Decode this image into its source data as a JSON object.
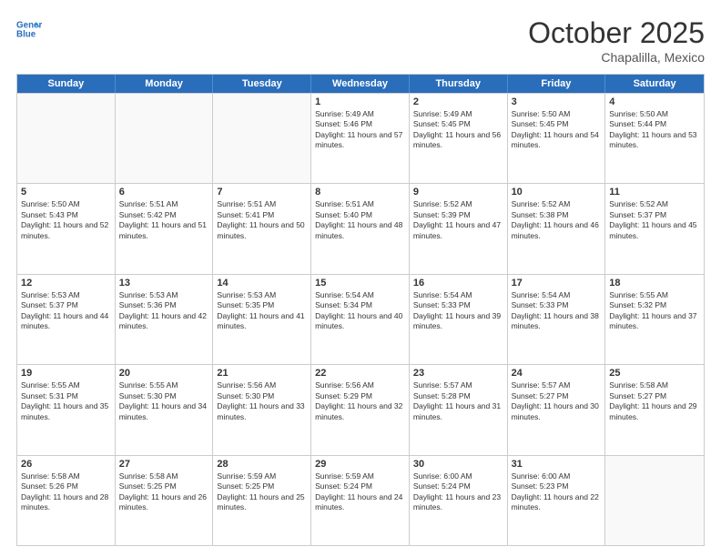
{
  "header": {
    "logo_general": "General",
    "logo_blue": "Blue",
    "month": "October 2025",
    "location": "Chapalilla, Mexico"
  },
  "days_of_week": [
    "Sunday",
    "Monday",
    "Tuesday",
    "Wednesday",
    "Thursday",
    "Friday",
    "Saturday"
  ],
  "weeks": [
    [
      {
        "day": "",
        "empty": true
      },
      {
        "day": "",
        "empty": true
      },
      {
        "day": "",
        "empty": true
      },
      {
        "day": "1",
        "sunrise": "Sunrise: 5:49 AM",
        "sunset": "Sunset: 5:46 PM",
        "daylight": "Daylight: 11 hours and 57 minutes."
      },
      {
        "day": "2",
        "sunrise": "Sunrise: 5:49 AM",
        "sunset": "Sunset: 5:45 PM",
        "daylight": "Daylight: 11 hours and 56 minutes."
      },
      {
        "day": "3",
        "sunrise": "Sunrise: 5:50 AM",
        "sunset": "Sunset: 5:45 PM",
        "daylight": "Daylight: 11 hours and 54 minutes."
      },
      {
        "day": "4",
        "sunrise": "Sunrise: 5:50 AM",
        "sunset": "Sunset: 5:44 PM",
        "daylight": "Daylight: 11 hours and 53 minutes."
      }
    ],
    [
      {
        "day": "5",
        "sunrise": "Sunrise: 5:50 AM",
        "sunset": "Sunset: 5:43 PM",
        "daylight": "Daylight: 11 hours and 52 minutes."
      },
      {
        "day": "6",
        "sunrise": "Sunrise: 5:51 AM",
        "sunset": "Sunset: 5:42 PM",
        "daylight": "Daylight: 11 hours and 51 minutes."
      },
      {
        "day": "7",
        "sunrise": "Sunrise: 5:51 AM",
        "sunset": "Sunset: 5:41 PM",
        "daylight": "Daylight: 11 hours and 50 minutes."
      },
      {
        "day": "8",
        "sunrise": "Sunrise: 5:51 AM",
        "sunset": "Sunset: 5:40 PM",
        "daylight": "Daylight: 11 hours and 48 minutes."
      },
      {
        "day": "9",
        "sunrise": "Sunrise: 5:52 AM",
        "sunset": "Sunset: 5:39 PM",
        "daylight": "Daylight: 11 hours and 47 minutes."
      },
      {
        "day": "10",
        "sunrise": "Sunrise: 5:52 AM",
        "sunset": "Sunset: 5:38 PM",
        "daylight": "Daylight: 11 hours and 46 minutes."
      },
      {
        "day": "11",
        "sunrise": "Sunrise: 5:52 AM",
        "sunset": "Sunset: 5:37 PM",
        "daylight": "Daylight: 11 hours and 45 minutes."
      }
    ],
    [
      {
        "day": "12",
        "sunrise": "Sunrise: 5:53 AM",
        "sunset": "Sunset: 5:37 PM",
        "daylight": "Daylight: 11 hours and 44 minutes."
      },
      {
        "day": "13",
        "sunrise": "Sunrise: 5:53 AM",
        "sunset": "Sunset: 5:36 PM",
        "daylight": "Daylight: 11 hours and 42 minutes."
      },
      {
        "day": "14",
        "sunrise": "Sunrise: 5:53 AM",
        "sunset": "Sunset: 5:35 PM",
        "daylight": "Daylight: 11 hours and 41 minutes."
      },
      {
        "day": "15",
        "sunrise": "Sunrise: 5:54 AM",
        "sunset": "Sunset: 5:34 PM",
        "daylight": "Daylight: 11 hours and 40 minutes."
      },
      {
        "day": "16",
        "sunrise": "Sunrise: 5:54 AM",
        "sunset": "Sunset: 5:33 PM",
        "daylight": "Daylight: 11 hours and 39 minutes."
      },
      {
        "day": "17",
        "sunrise": "Sunrise: 5:54 AM",
        "sunset": "Sunset: 5:33 PM",
        "daylight": "Daylight: 11 hours and 38 minutes."
      },
      {
        "day": "18",
        "sunrise": "Sunrise: 5:55 AM",
        "sunset": "Sunset: 5:32 PM",
        "daylight": "Daylight: 11 hours and 37 minutes."
      }
    ],
    [
      {
        "day": "19",
        "sunrise": "Sunrise: 5:55 AM",
        "sunset": "Sunset: 5:31 PM",
        "daylight": "Daylight: 11 hours and 35 minutes."
      },
      {
        "day": "20",
        "sunrise": "Sunrise: 5:55 AM",
        "sunset": "Sunset: 5:30 PM",
        "daylight": "Daylight: 11 hours and 34 minutes."
      },
      {
        "day": "21",
        "sunrise": "Sunrise: 5:56 AM",
        "sunset": "Sunset: 5:30 PM",
        "daylight": "Daylight: 11 hours and 33 minutes."
      },
      {
        "day": "22",
        "sunrise": "Sunrise: 5:56 AM",
        "sunset": "Sunset: 5:29 PM",
        "daylight": "Daylight: 11 hours and 32 minutes."
      },
      {
        "day": "23",
        "sunrise": "Sunrise: 5:57 AM",
        "sunset": "Sunset: 5:28 PM",
        "daylight": "Daylight: 11 hours and 31 minutes."
      },
      {
        "day": "24",
        "sunrise": "Sunrise: 5:57 AM",
        "sunset": "Sunset: 5:27 PM",
        "daylight": "Daylight: 11 hours and 30 minutes."
      },
      {
        "day": "25",
        "sunrise": "Sunrise: 5:58 AM",
        "sunset": "Sunset: 5:27 PM",
        "daylight": "Daylight: 11 hours and 29 minutes."
      }
    ],
    [
      {
        "day": "26",
        "sunrise": "Sunrise: 5:58 AM",
        "sunset": "Sunset: 5:26 PM",
        "daylight": "Daylight: 11 hours and 28 minutes."
      },
      {
        "day": "27",
        "sunrise": "Sunrise: 5:58 AM",
        "sunset": "Sunset: 5:25 PM",
        "daylight": "Daylight: 11 hours and 26 minutes."
      },
      {
        "day": "28",
        "sunrise": "Sunrise: 5:59 AM",
        "sunset": "Sunset: 5:25 PM",
        "daylight": "Daylight: 11 hours and 25 minutes."
      },
      {
        "day": "29",
        "sunrise": "Sunrise: 5:59 AM",
        "sunset": "Sunset: 5:24 PM",
        "daylight": "Daylight: 11 hours and 24 minutes."
      },
      {
        "day": "30",
        "sunrise": "Sunrise: 6:00 AM",
        "sunset": "Sunset: 5:24 PM",
        "daylight": "Daylight: 11 hours and 23 minutes."
      },
      {
        "day": "31",
        "sunrise": "Sunrise: 6:00 AM",
        "sunset": "Sunset: 5:23 PM",
        "daylight": "Daylight: 11 hours and 22 minutes."
      },
      {
        "day": "",
        "empty": true
      }
    ]
  ]
}
